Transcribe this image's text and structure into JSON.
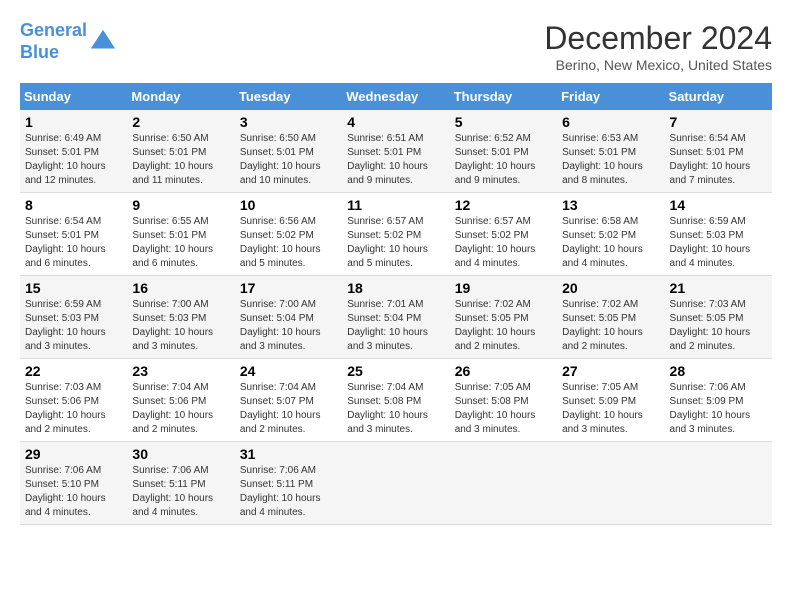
{
  "logo": {
    "line1": "General",
    "line2": "Blue"
  },
  "title": "December 2024",
  "subtitle": "Berino, New Mexico, United States",
  "weekdays": [
    "Sunday",
    "Monday",
    "Tuesday",
    "Wednesday",
    "Thursday",
    "Friday",
    "Saturday"
  ],
  "weeks": [
    [
      {
        "day": "1",
        "info": "Sunrise: 6:49 AM\nSunset: 5:01 PM\nDaylight: 10 hours\nand 12 minutes."
      },
      {
        "day": "2",
        "info": "Sunrise: 6:50 AM\nSunset: 5:01 PM\nDaylight: 10 hours\nand 11 minutes."
      },
      {
        "day": "3",
        "info": "Sunrise: 6:50 AM\nSunset: 5:01 PM\nDaylight: 10 hours\nand 10 minutes."
      },
      {
        "day": "4",
        "info": "Sunrise: 6:51 AM\nSunset: 5:01 PM\nDaylight: 10 hours\nand 9 minutes."
      },
      {
        "day": "5",
        "info": "Sunrise: 6:52 AM\nSunset: 5:01 PM\nDaylight: 10 hours\nand 9 minutes."
      },
      {
        "day": "6",
        "info": "Sunrise: 6:53 AM\nSunset: 5:01 PM\nDaylight: 10 hours\nand 8 minutes."
      },
      {
        "day": "7",
        "info": "Sunrise: 6:54 AM\nSunset: 5:01 PM\nDaylight: 10 hours\nand 7 minutes."
      }
    ],
    [
      {
        "day": "8",
        "info": "Sunrise: 6:54 AM\nSunset: 5:01 PM\nDaylight: 10 hours\nand 6 minutes."
      },
      {
        "day": "9",
        "info": "Sunrise: 6:55 AM\nSunset: 5:01 PM\nDaylight: 10 hours\nand 6 minutes."
      },
      {
        "day": "10",
        "info": "Sunrise: 6:56 AM\nSunset: 5:02 PM\nDaylight: 10 hours\nand 5 minutes."
      },
      {
        "day": "11",
        "info": "Sunrise: 6:57 AM\nSunset: 5:02 PM\nDaylight: 10 hours\nand 5 minutes."
      },
      {
        "day": "12",
        "info": "Sunrise: 6:57 AM\nSunset: 5:02 PM\nDaylight: 10 hours\nand 4 minutes."
      },
      {
        "day": "13",
        "info": "Sunrise: 6:58 AM\nSunset: 5:02 PM\nDaylight: 10 hours\nand 4 minutes."
      },
      {
        "day": "14",
        "info": "Sunrise: 6:59 AM\nSunset: 5:03 PM\nDaylight: 10 hours\nand 4 minutes."
      }
    ],
    [
      {
        "day": "15",
        "info": "Sunrise: 6:59 AM\nSunset: 5:03 PM\nDaylight: 10 hours\nand 3 minutes."
      },
      {
        "day": "16",
        "info": "Sunrise: 7:00 AM\nSunset: 5:03 PM\nDaylight: 10 hours\nand 3 minutes."
      },
      {
        "day": "17",
        "info": "Sunrise: 7:00 AM\nSunset: 5:04 PM\nDaylight: 10 hours\nand 3 minutes."
      },
      {
        "day": "18",
        "info": "Sunrise: 7:01 AM\nSunset: 5:04 PM\nDaylight: 10 hours\nand 3 minutes."
      },
      {
        "day": "19",
        "info": "Sunrise: 7:02 AM\nSunset: 5:05 PM\nDaylight: 10 hours\nand 2 minutes."
      },
      {
        "day": "20",
        "info": "Sunrise: 7:02 AM\nSunset: 5:05 PM\nDaylight: 10 hours\nand 2 minutes."
      },
      {
        "day": "21",
        "info": "Sunrise: 7:03 AM\nSunset: 5:05 PM\nDaylight: 10 hours\nand 2 minutes."
      }
    ],
    [
      {
        "day": "22",
        "info": "Sunrise: 7:03 AM\nSunset: 5:06 PM\nDaylight: 10 hours\nand 2 minutes."
      },
      {
        "day": "23",
        "info": "Sunrise: 7:04 AM\nSunset: 5:06 PM\nDaylight: 10 hours\nand 2 minutes."
      },
      {
        "day": "24",
        "info": "Sunrise: 7:04 AM\nSunset: 5:07 PM\nDaylight: 10 hours\nand 2 minutes."
      },
      {
        "day": "25",
        "info": "Sunrise: 7:04 AM\nSunset: 5:08 PM\nDaylight: 10 hours\nand 3 minutes."
      },
      {
        "day": "26",
        "info": "Sunrise: 7:05 AM\nSunset: 5:08 PM\nDaylight: 10 hours\nand 3 minutes."
      },
      {
        "day": "27",
        "info": "Sunrise: 7:05 AM\nSunset: 5:09 PM\nDaylight: 10 hours\nand 3 minutes."
      },
      {
        "day": "28",
        "info": "Sunrise: 7:06 AM\nSunset: 5:09 PM\nDaylight: 10 hours\nand 3 minutes."
      }
    ],
    [
      {
        "day": "29",
        "info": "Sunrise: 7:06 AM\nSunset: 5:10 PM\nDaylight: 10 hours\nand 4 minutes."
      },
      {
        "day": "30",
        "info": "Sunrise: 7:06 AM\nSunset: 5:11 PM\nDaylight: 10 hours\nand 4 minutes."
      },
      {
        "day": "31",
        "info": "Sunrise: 7:06 AM\nSunset: 5:11 PM\nDaylight: 10 hours\nand 4 minutes."
      },
      {
        "day": "",
        "info": ""
      },
      {
        "day": "",
        "info": ""
      },
      {
        "day": "",
        "info": ""
      },
      {
        "day": "",
        "info": ""
      }
    ]
  ]
}
